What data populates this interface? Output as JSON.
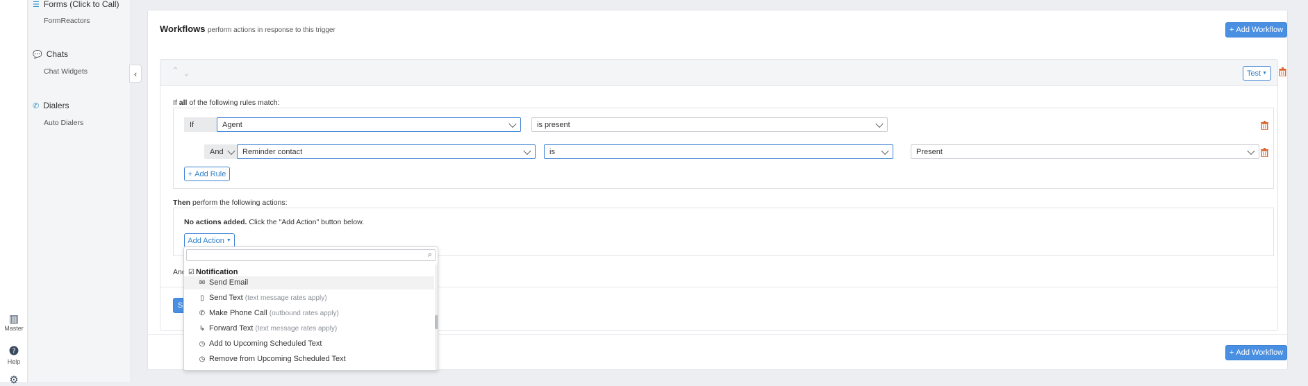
{
  "sidebar": {
    "sections": [
      {
        "title": "Forms (Click to Call)",
        "icon": "list-icon",
        "items": [
          "FormReactors"
        ]
      },
      {
        "title": "Chats",
        "icon": "chat-icon",
        "items": [
          "Chat Widgets"
        ]
      },
      {
        "title": "Dialers",
        "icon": "phone-icon",
        "items": [
          "Auto Dialers"
        ]
      }
    ]
  },
  "rail": {
    "master_label": "Master",
    "help_label": "Help"
  },
  "workflows": {
    "title": "Workflows",
    "subtitle": "perform actions in response to this trigger",
    "add_workflow_label": "Add Workflow",
    "test_label": "Test",
    "rules_intro_pre": "If ",
    "rules_intro_bold": "all",
    "rules_intro_post": " of the following rules match:",
    "rules": [
      {
        "connector": "If",
        "field": "Agent",
        "operator": "is present",
        "value": ""
      },
      {
        "connector": "And",
        "field": "Reminder contact",
        "operator": "is",
        "value": "Present"
      }
    ],
    "add_rule_label": "Add Rule",
    "actions_intro_bold": "Then",
    "actions_intro_post": " perform the following actions:",
    "no_actions_bold": "No actions added.",
    "no_actions_post": " Click the \"Add Action\" button below.",
    "add_action_label": "Add Action",
    "and_partial": "And",
    "save_partial": "S"
  },
  "dropdown": {
    "search_value": "",
    "group_title": "Notification",
    "items": [
      {
        "label": "Send Email",
        "note": "",
        "icon": "envelope-icon"
      },
      {
        "label": "Send Text",
        "note": "(text message rates apply)",
        "icon": "mobile-icon"
      },
      {
        "label": "Make Phone Call",
        "note": "(outbound rates apply)",
        "icon": "phone-outgoing-icon"
      },
      {
        "label": "Forward Text",
        "note": "(text message rates apply)",
        "icon": "forward-icon"
      },
      {
        "label": "Add to Upcoming Scheduled Text",
        "note": "",
        "icon": "clock-icon"
      },
      {
        "label": "Remove from Upcoming Scheduled Text",
        "note": "",
        "icon": "clock-icon"
      }
    ]
  },
  "colors": {
    "accent": "#4a90e2",
    "trash": "#d9662f",
    "sidebar_icon": "#2a8fd1"
  }
}
